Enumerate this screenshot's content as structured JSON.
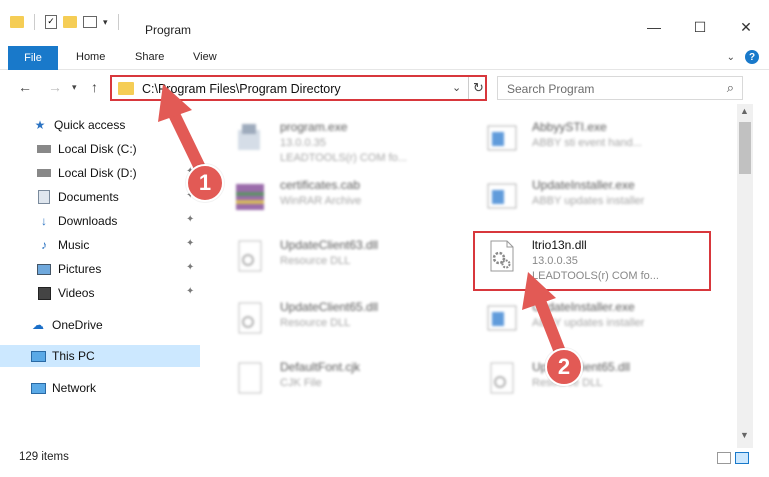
{
  "window": {
    "title": "Program",
    "controls": {
      "minimize": "—",
      "maximize": "☐",
      "close": "✕"
    }
  },
  "ribbon": {
    "file": "File",
    "tabs": [
      "Home",
      "Share",
      "View"
    ]
  },
  "address": {
    "path": "C:\\Program Files\\Program Directory"
  },
  "search": {
    "placeholder": "Search Program"
  },
  "sidebar": {
    "items": [
      {
        "label": "Quick access",
        "icon": "star-icon"
      },
      {
        "label": "Local Disk (C:)",
        "icon": "drive-icon"
      },
      {
        "label": "Local Disk (D:)",
        "icon": "drive-icon"
      },
      {
        "label": "Documents",
        "icon": "documents-icon"
      },
      {
        "label": "Downloads",
        "icon": "download-icon"
      },
      {
        "label": "Music",
        "icon": "music-icon"
      },
      {
        "label": "Pictures",
        "icon": "pictures-icon"
      },
      {
        "label": "Videos",
        "icon": "videos-icon"
      },
      {
        "label": "OneDrive",
        "icon": "cloud-icon"
      },
      {
        "label": "This PC",
        "icon": "computer-icon"
      },
      {
        "label": "Network",
        "icon": "network-icon"
      }
    ]
  },
  "files": [
    {
      "name": "program.exe",
      "line2": "13.0.0.35",
      "line3": "LEADTOOLS(r) COM fo..."
    },
    {
      "name": "AbbyySTI.exe",
      "line2": "ABBY sti event hand...",
      "line3": ""
    },
    {
      "name": "certificates.cab",
      "line2": "WinRAR Archive",
      "line3": ""
    },
    {
      "name": "UpdateInstaller.exe",
      "line2": "ABBY updates installer",
      "line3": ""
    },
    {
      "name": "UpdateClient63.dll",
      "line2": "Resource DLL",
      "line3": ""
    },
    {
      "name": "ltrio13n.dll",
      "line2": "13.0.0.35",
      "line3": "LEADTOOLS(r) COM fo..."
    },
    {
      "name": "UpdateClient65.dll",
      "line2": "Resource DLL",
      "line3": ""
    },
    {
      "name": "UpdateInstaller.exe",
      "line2": "ABBY updates installer",
      "line3": ""
    },
    {
      "name": "DefaultFont.cjk",
      "line2": "CJK File",
      "line3": ""
    },
    {
      "name": "UpdateClient65.dll",
      "line2": "Resource DLL",
      "line3": ""
    }
  ],
  "annotations": {
    "step1": "1",
    "step2": "2"
  },
  "status": {
    "items": "129 items"
  },
  "colors": {
    "accent": "#1979ca",
    "highlight": "#d8373c",
    "badge": "#e25a55",
    "selected": "#cce8ff"
  }
}
